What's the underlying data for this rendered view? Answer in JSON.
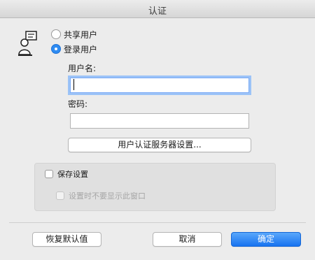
{
  "window": {
    "title": "认证"
  },
  "auth_mode": {
    "options": [
      {
        "label": "共享用户",
        "selected": false
      },
      {
        "label": "登录用户",
        "selected": true
      }
    ]
  },
  "form": {
    "username_label": "用户名:",
    "username_value": "",
    "password_label": "密码:",
    "password_value": "",
    "server_settings_label": "用户认证服务器设置..."
  },
  "settings_group": {
    "save_settings_label": "保存设置",
    "save_settings_checked": false,
    "dont_show_label": "设置时不要显示此窗口",
    "dont_show_checked": false,
    "dont_show_enabled": false
  },
  "buttons": {
    "restore_defaults": "恢复默认值",
    "cancel": "取消",
    "ok": "确定"
  },
  "colors": {
    "accent": "#2f8cf2",
    "window_bg": "#ececec"
  },
  "icons": {
    "user_mode": "user-terminal-icon"
  }
}
